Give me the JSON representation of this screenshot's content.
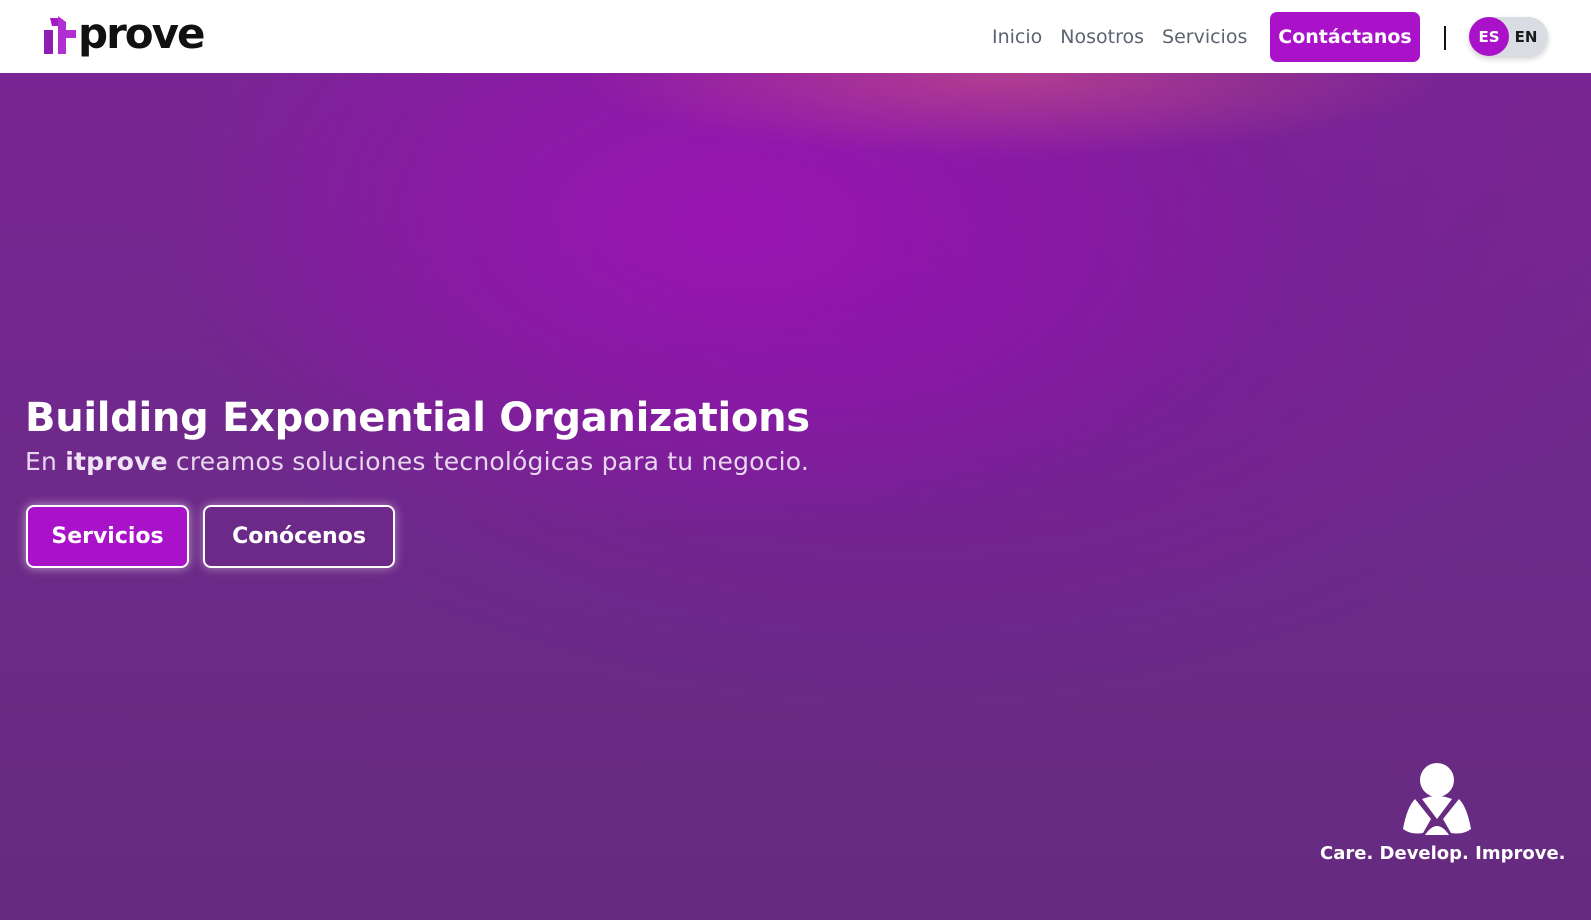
{
  "header": {
    "logo_text": "prove",
    "logo_full": "itprove",
    "nav": [
      {
        "label": "Inicio"
      },
      {
        "label": "Nosotros"
      },
      {
        "label": "Servicios"
      }
    ],
    "contact_label": "Contáctanos",
    "languages": {
      "active": "ES",
      "inactive": "EN"
    }
  },
  "hero": {
    "title": "Building Exponential Organizations",
    "subtitle_prefix": "En ",
    "subtitle_brand": "itprove",
    "subtitle_suffix": " creamos soluciones tecnológicas para tu negocio.",
    "primary_button": "Servicios",
    "secondary_button": "Conócenos"
  },
  "badge": {
    "icon": "people-group-icon",
    "tagline": "Care. Develop. Improve."
  },
  "colors": {
    "accent": "#a912c9",
    "hero_bg": "#652b80",
    "nav_text": "#5d6470"
  }
}
